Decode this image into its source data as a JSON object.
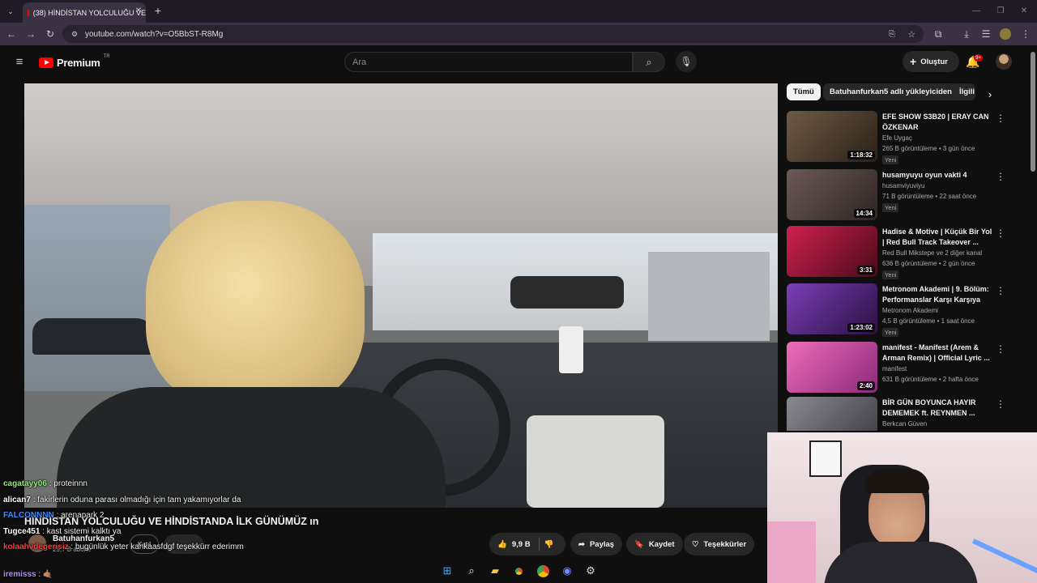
{
  "browser": {
    "tab_title": "(38) HİNDİSTAN YOLCULUĞU VE",
    "url": "youtube.com/watch?v=O5BbST-R8Mg"
  },
  "youtube": {
    "logo": "Premium",
    "logo_region": "TR",
    "search_placeholder": "Ara",
    "create_label": "Oluştur",
    "notif_badge": "9+"
  },
  "video": {
    "title": "HİNDİSTAN YOLCULUĞU VE HİNDİSTANDA İLK GÜNÜMÜZ ın",
    "channel": "Batuhanfurkan5",
    "subscribers": "29,7 B abone",
    "join_label": "Katıl",
    "likes": "9,9 B",
    "share": "Paylaş",
    "save": "Kaydet",
    "thanks": "Teşekkürler"
  },
  "chips": [
    "Tümü",
    "Batuhanfurkan5 adlı yükleyiciden",
    "İlgili"
  ],
  "recommendations": [
    {
      "title": "EFE SHOW S3B20 | ERAY CAN ÖZKENAR",
      "channel": "Efe Uygaç",
      "meta": "265 B görüntüleme • 3 gün önce",
      "badge": "Yeni",
      "duration": "1:18:32",
      "color": "#5a4632"
    },
    {
      "title": "husamyuyu oyun vakti 4",
      "channel": "husamviyuviyu",
      "meta": "71 B görüntüleme • 22 saat önce",
      "badge": "Yeni",
      "duration": "14:34",
      "color": "#584844"
    },
    {
      "title": "Hadise & Motive | Küçük Bir Yol | Red Bull Track Takeover ...",
      "channel": "Red Bull Mikstepe ve 2 diğer kanal",
      "meta": "636 B görüntüleme • 2 gün önce",
      "badge": "Yeni",
      "duration": "3:31",
      "color": "#b1123a"
    },
    {
      "title": "Metronom Akademi | 9. Bölüm: Performanslar Karşı Karşıya",
      "channel": "Metronom Akademi",
      "meta": "4,5 B görüntüleme • 1 saat önce",
      "badge": "Yeni",
      "duration": "1:23:02",
      "color": "#5a2a86"
    },
    {
      "title": "manifest - Manifest (Arem & Arman Remix) | Official Lyric ...",
      "channel": "manifest",
      "meta": "631 B görüntüleme • 2 hafta önce",
      "badge": "",
      "duration": "2:40",
      "color": "#d24f9c"
    },
    {
      "title": "BİR GÜN BOYUNCA HAYIR DEMEMEK ft. REYNMEN ...",
      "channel": "Berkcan Güven",
      "meta": "",
      "badge": "",
      "duration": "",
      "color": "#6a6a70"
    }
  ],
  "chat": [
    {
      "user": "cagatayy06",
      "text": ": proteinnn",
      "color": "#8cf06a"
    },
    {
      "user": "alican7",
      "text": ": fakirlerin oduna parası olmadığı için tam yakamıyorlar da",
      "color": "#ffffff"
    },
    {
      "user": "FALCONNNN",
      "text": ": arenapark 2",
      "color": "#3f8cff"
    },
    {
      "user": "Tugce451",
      "text": ": kast sistemi kalktı ya",
      "color": "#ffffff"
    },
    {
      "user": "kolaahvdegerisiz",
      "text": ": bugünlük yeter kankaasfdgf teşekkürr ederimm",
      "color": "#ff3b3b"
    },
    {
      "user": "iremisss",
      "text": ": 🤙🏽",
      "color": "#b58cff"
    }
  ]
}
